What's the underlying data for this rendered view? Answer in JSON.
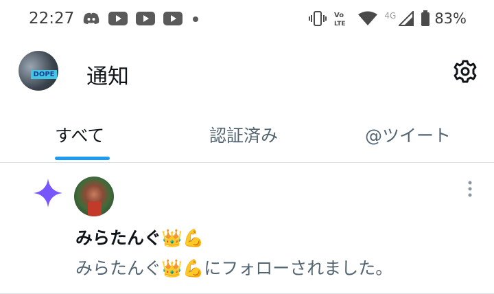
{
  "status_bar": {
    "time": "22:27",
    "battery_percent": "83%",
    "network_label": "4G"
  },
  "header": {
    "title": "通知",
    "avatar_badge": "DOPE"
  },
  "tabs": [
    {
      "label": "すべて",
      "active": true
    },
    {
      "label": "認証済み",
      "active": false
    },
    {
      "label": "@ツイート",
      "active": false
    }
  ],
  "notification": {
    "icon": "sparkle-icon",
    "user_name": "みらたんぐ👑💪",
    "text": "みらたんぐ👑💪にフォローされました。"
  },
  "colors": {
    "accent": "#1d9bf0",
    "sparkle": "#7856ff",
    "secondary_text": "#536471"
  }
}
